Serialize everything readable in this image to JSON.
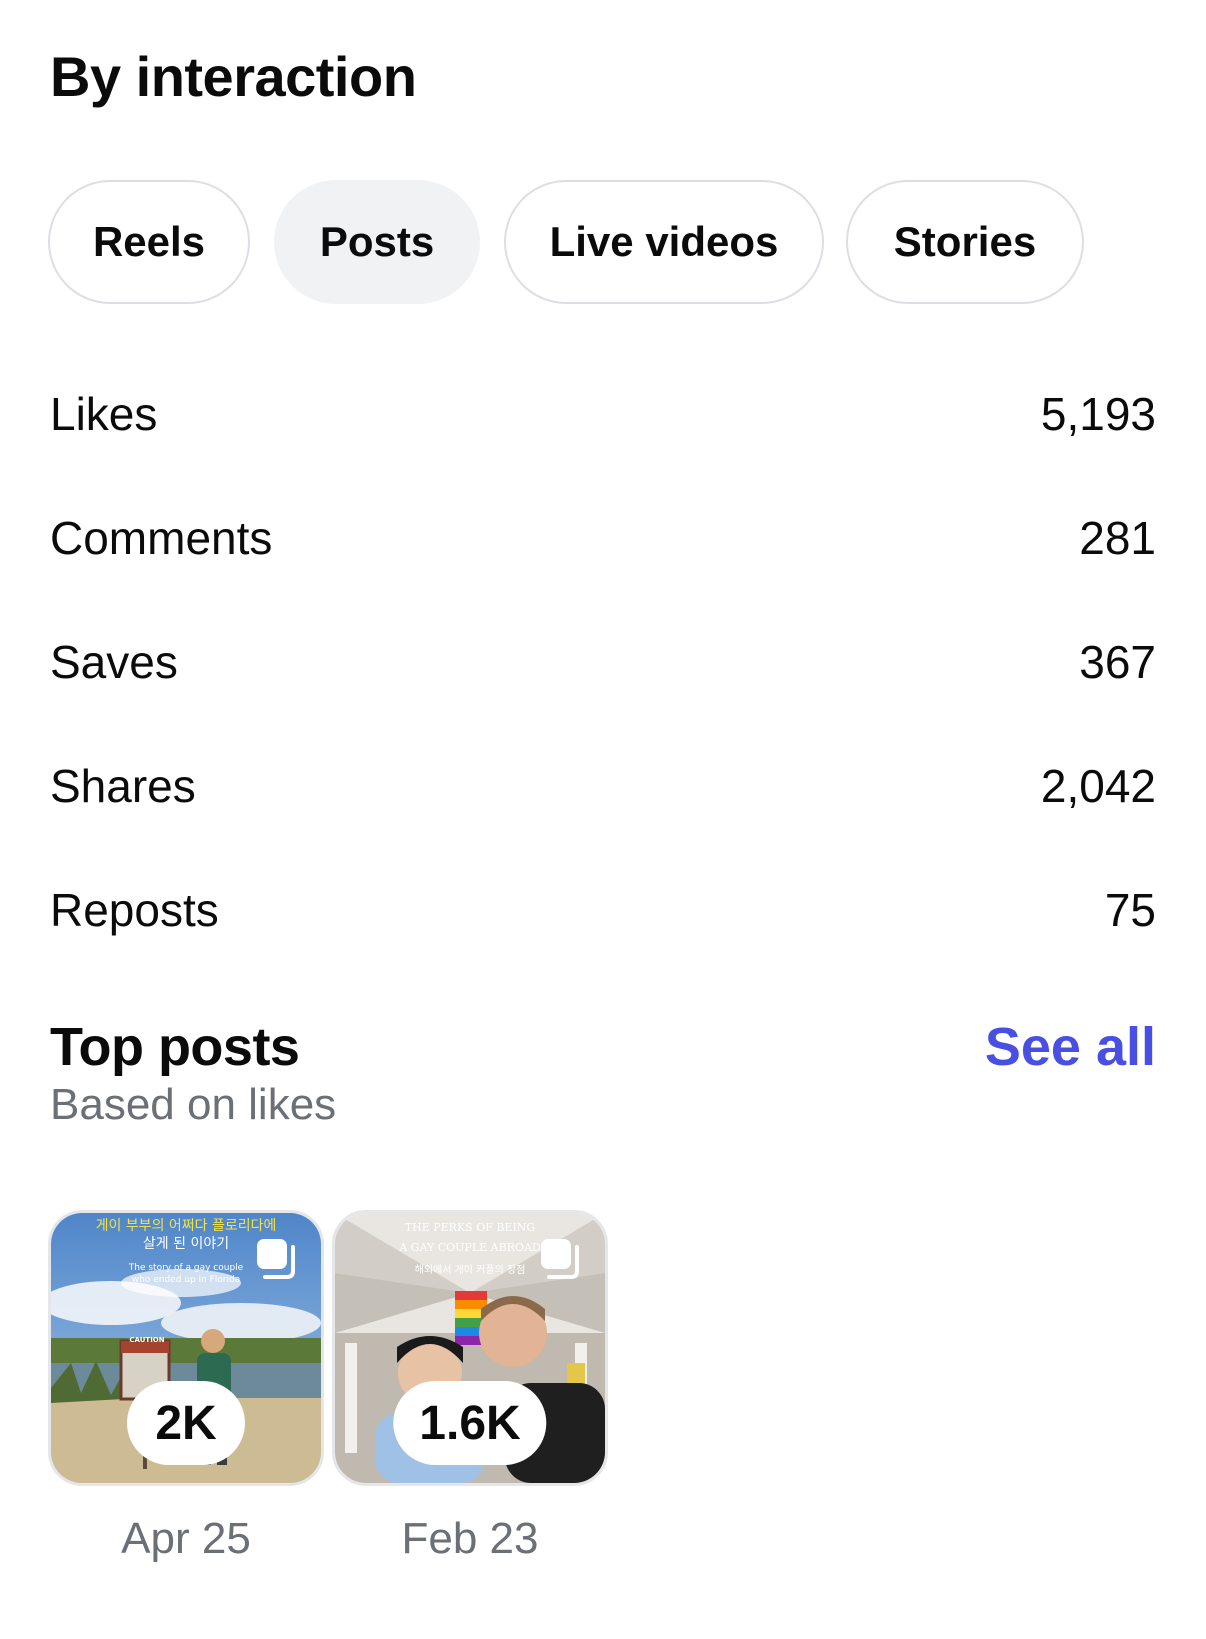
{
  "interaction": {
    "title": "By interaction",
    "tabs": [
      {
        "label": "Reels",
        "active": false
      },
      {
        "label": "Posts",
        "active": true
      },
      {
        "label": "Live videos",
        "active": false
      },
      {
        "label": "Stories",
        "active": false
      }
    ],
    "metrics": [
      {
        "label": "Likes",
        "value": "5,193"
      },
      {
        "label": "Comments",
        "value": "281"
      },
      {
        "label": "Saves",
        "value": "367"
      },
      {
        "label": "Shares",
        "value": "2,042"
      },
      {
        "label": "Reposts",
        "value": "75"
      }
    ]
  },
  "top_posts": {
    "title": "Top posts",
    "subtitle": "Based on likes",
    "see_all_label": "See all",
    "accent_color": "#4a4fe4",
    "items": [
      {
        "count": "2K",
        "date": "Apr 25",
        "overlay_line1": "게이 부부의 어쩌다 플로리다에",
        "overlay_line2": "살게 된 이야기",
        "overlay_line3": "The story of a gay couple",
        "overlay_line4": "who ended up in Florida",
        "sign_text": "CAUTION",
        "icon": "multi-photo-icon"
      },
      {
        "count": "1.6K",
        "date": "Feb 23",
        "overlay_line1": "THE PERKS OF BEING",
        "overlay_line2": "A GAY COUPLE ABROAD",
        "overlay_line3": "해외에서 게이 커플의 장점",
        "icon": "multi-photo-icon"
      }
    ]
  }
}
